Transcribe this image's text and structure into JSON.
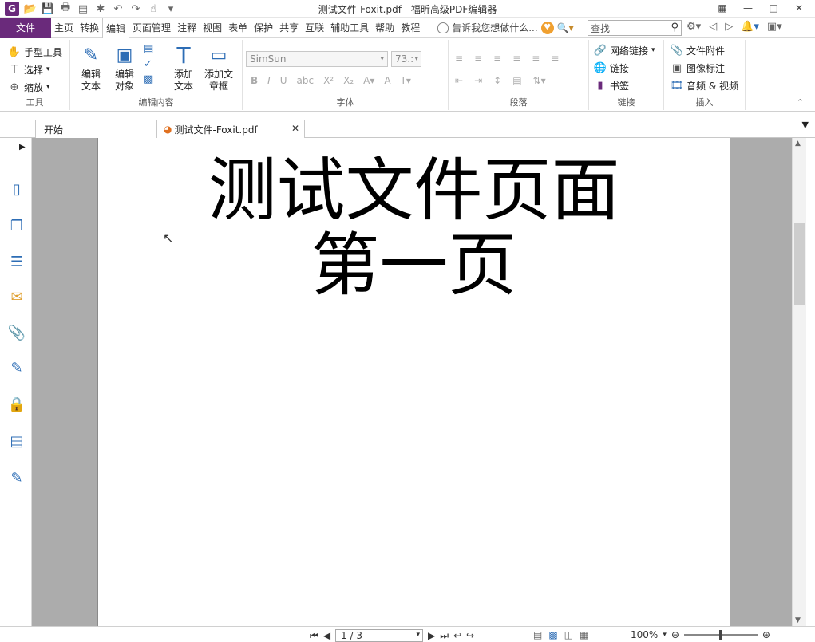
{
  "window": {
    "title": "测试文件-Foxit.pdf - 福昕高级PDF编辑器",
    "logo": "G"
  },
  "menu": {
    "file": "文件",
    "tabs": [
      "主页",
      "转换",
      "编辑",
      "页面管理",
      "注释",
      "视图",
      "表单",
      "保护",
      "共享",
      "互联",
      "辅助工具",
      "帮助",
      "教程"
    ],
    "active_tab": "编辑",
    "tell_me": "告诉我您想做什么...",
    "search_placeholder": "查找"
  },
  "ribbon": {
    "tools": {
      "hand": "手型工具",
      "select": "选择",
      "zoom": "缩放",
      "label": "工具"
    },
    "edit_content": {
      "edit_text": "编辑文本",
      "edit_object": "编辑对象",
      "add_text": "添加文本",
      "add_textbox": "添加文章框",
      "label": "编辑内容"
    },
    "font": {
      "family": "SimSun",
      "size": "73.:",
      "label": "字体"
    },
    "paragraph": {
      "label": "段落"
    },
    "links": {
      "web_link": "网络链接",
      "link": "链接",
      "bookmark": "书签",
      "label": "链接"
    },
    "insert": {
      "attachment": "文件附件",
      "image_annot": "图像标注",
      "audio_video": "音频 & 视频",
      "label": "插入"
    }
  },
  "doc_tabs": [
    {
      "label": "开始"
    },
    {
      "label": "测试文件-Foxit.pdf"
    }
  ],
  "page": {
    "line1": "测试文件页面",
    "line2": "第一页"
  },
  "status": {
    "page": "1 / 3",
    "zoom": "100%"
  },
  "colors": {
    "brand": "#6a2a7b",
    "accent": "#2d6db5"
  }
}
